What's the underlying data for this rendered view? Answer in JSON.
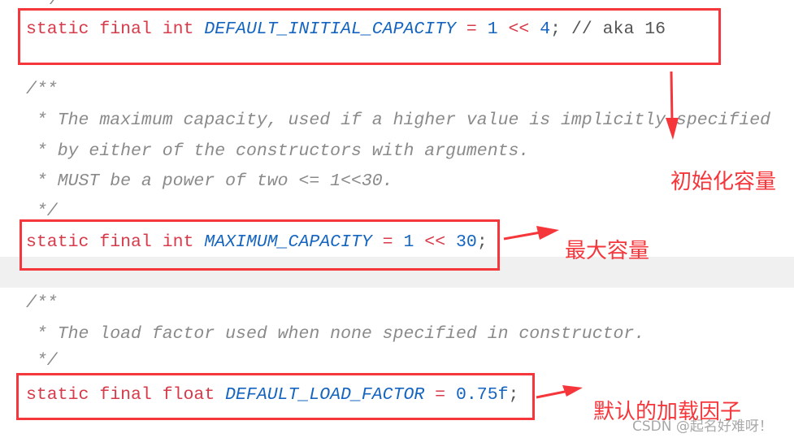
{
  "code": {
    "top_fragment": "*/",
    "line1": {
      "kw": "static final int ",
      "name": "DEFAULT_INITIAL_CAPACITY",
      "eq": " = ",
      "n1": "1",
      "op": " << ",
      "n2": "4",
      "rest": "; // aka 16"
    },
    "comment1": [
      "/**",
      " * The maximum capacity, used if a higher value is implicitly specified",
      " * by either of the constructors with arguments.",
      " * MUST be a power of two <= 1<<30.",
      " */"
    ],
    "line2": {
      "kw": "static final int ",
      "name": "MAXIMUM_CAPACITY",
      "eq": " = ",
      "n1": "1",
      "op": " << ",
      "n2": "30",
      "rest": ";"
    },
    "comment2": [
      "/**",
      " * The load factor used when none specified in constructor.",
      " */"
    ],
    "line3": {
      "kw": "static final float ",
      "name": "DEFAULT_LOAD_FACTOR",
      "eq": " = ",
      "n1": "0.75f",
      "rest": ";"
    }
  },
  "annotations": {
    "initial_capacity": "初始化容量",
    "maximum_capacity": "最大容量",
    "load_factor": "默认的加载因子"
  },
  "watermark": "CSDN @起名好难呀！",
  "colors": {
    "annotation": "#f5363b",
    "keyword": "#d73a49",
    "constant": "#1565c0",
    "comment": "#8a8a8a"
  }
}
